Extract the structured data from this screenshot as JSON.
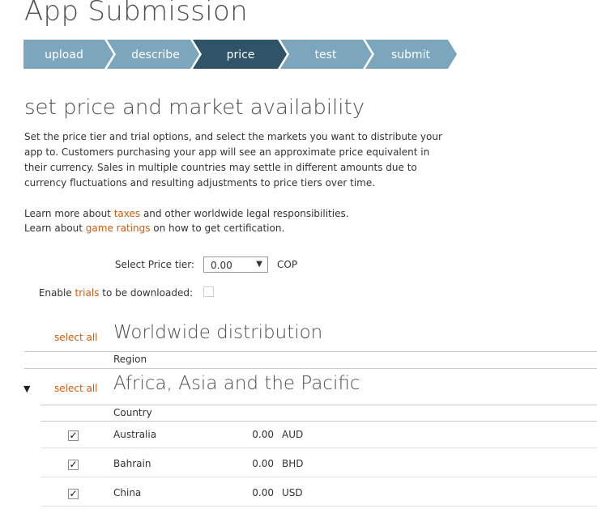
{
  "page": {
    "title": "App Submission"
  },
  "steps": [
    {
      "label": "upload",
      "active": false
    },
    {
      "label": "describe",
      "active": false
    },
    {
      "label": "price",
      "active": true
    },
    {
      "label": "test",
      "active": false
    },
    {
      "label": "submit",
      "active": false
    }
  ],
  "colors": {
    "step_inactive": "#7ba6bc",
    "step_active": "#2f5468",
    "link": "#d05a0b"
  },
  "section": {
    "title": "set price and market availability",
    "description": "Set the price tier and trial options, and select the markets you want to distribute your app to. Customers purchasing your app will see an approximate price equivalent in their currency. Sales in multiple countries may settle in different amounts due to currency fluctuations and resulting adjustments to price tiers over time.",
    "taxes_line": {
      "prefix": "Learn more about ",
      "link": "taxes",
      "suffix": " and other worldwide legal responsibilities."
    },
    "ratings_line": {
      "prefix": "Learn about ",
      "link": "game ratings",
      "suffix": "  on how to get certification."
    }
  },
  "price_tier": {
    "label": "Select Price tier:",
    "value": "0.00",
    "currency": "COP"
  },
  "trials": {
    "prefix": "Enable ",
    "link": "trials",
    "suffix": " to be downloaded:",
    "checked": false
  },
  "worldwide": {
    "select_all": "select all",
    "title": "Worldwide distribution",
    "column": "Region"
  },
  "africa_asia": {
    "select_all": "select all",
    "title": "Africa, Asia and the Pacific",
    "column": "Country",
    "rows": [
      {
        "check": "✓",
        "country": "Australia",
        "price": "0.00",
        "currency": "AUD"
      },
      {
        "check": "✓",
        "country": "Bahrain",
        "price": "0.00",
        "currency": "BHD"
      },
      {
        "check": "✓",
        "country": "China",
        "price": "0.00",
        "currency": "USD"
      }
    ]
  },
  "icons": {
    "collapse": "triangle-down-icon",
    "step_chevron": "chevron-arrow-icon"
  }
}
